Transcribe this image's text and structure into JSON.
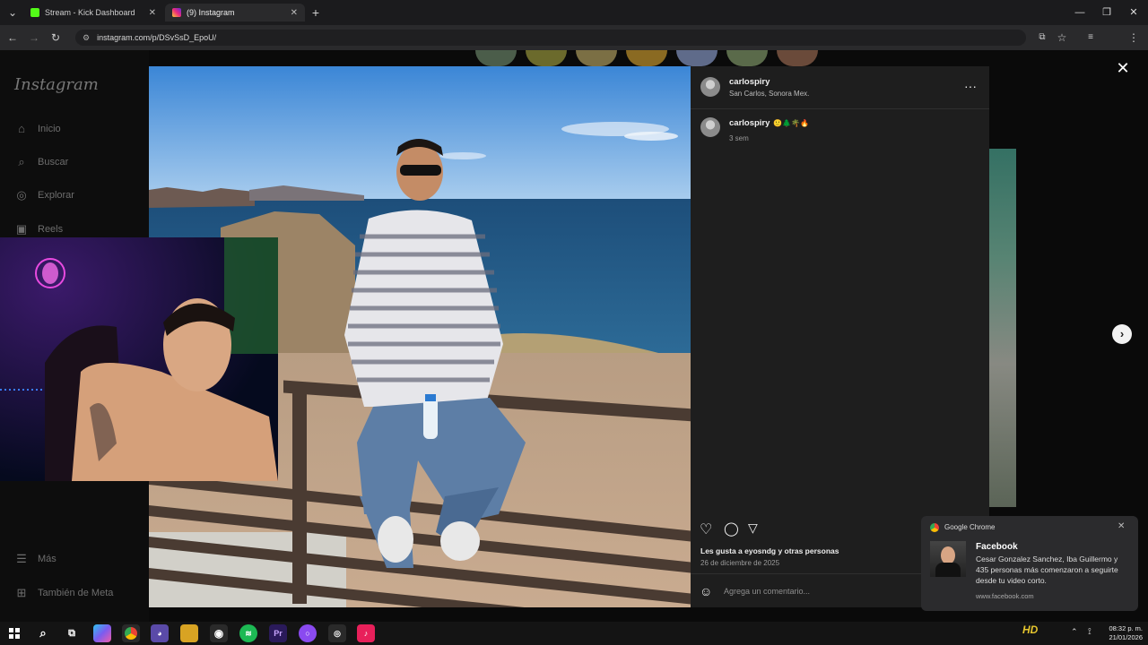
{
  "browser": {
    "tabs": [
      {
        "label": "Stream - Kick Dashboard",
        "favicon_color": "#53fc18",
        "active": false
      },
      {
        "label": "(9) Instagram",
        "favicon_color": "#d6249f",
        "active": true
      }
    ],
    "url": "instagram.com/p/DSvSsD_EpoU/"
  },
  "instagram": {
    "logo": "Instagram",
    "nav": [
      {
        "label": "Inicio",
        "icon": "home-icon"
      },
      {
        "label": "Buscar",
        "icon": "search-icon"
      },
      {
        "label": "Explorar",
        "icon": "compass-icon"
      },
      {
        "label": "Reels",
        "icon": "reels-icon"
      }
    ],
    "nav_bottom": [
      {
        "label": "Más",
        "icon": "menu-icon"
      },
      {
        "label": "También de Meta",
        "icon": "meta-icon"
      }
    ],
    "post": {
      "username": "carlospiry",
      "location": "San Carlos, Sonora Mex.",
      "caption_user": "carlospiry",
      "caption_emojis": "🙂🌲🌴🔥",
      "caption_age": "3 sem",
      "likes_text": "Les gusta a eyosndg y otras personas",
      "date": "26 de diciembre de 2025",
      "comment_placeholder": "Agrega un comentario..."
    }
  },
  "notification": {
    "source": "Google Chrome",
    "title": "Facebook",
    "body": "Cesar Gonzalez Sanchez, Iba Guillermo y 435 personas más comenzaron a seguirte desde tu video corto.",
    "site": "www.facebook.com"
  },
  "taskbar": {
    "time": "08:32 p. m.",
    "date": "21/01/2026"
  },
  "colors": {
    "kick_green": "#53fc18",
    "instagram_pink": "#d6249f",
    "panel_bg": "#1e1e1e"
  }
}
